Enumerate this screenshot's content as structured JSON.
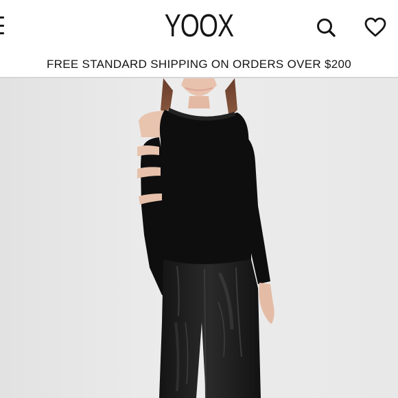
{
  "header": {
    "logo_text": "YOOX",
    "menu_icon": "hamburger-menu-icon",
    "search_icon": "search-icon",
    "wishlist_icon": "heart-icon"
  },
  "promo": {
    "text": "FREE STANDARD SHIPPING ON ORDERS OVER $200"
  },
  "product_image": {
    "content": "model-wearing-black-cutout-sleeve-sweater-and-black-leather-pants",
    "colors": {
      "sweater": "#0d0d0d",
      "pants": "#1b1b1b",
      "background": "#e6e6e6",
      "skin": "#e9c3ae",
      "hair": "#7a4a35"
    }
  }
}
